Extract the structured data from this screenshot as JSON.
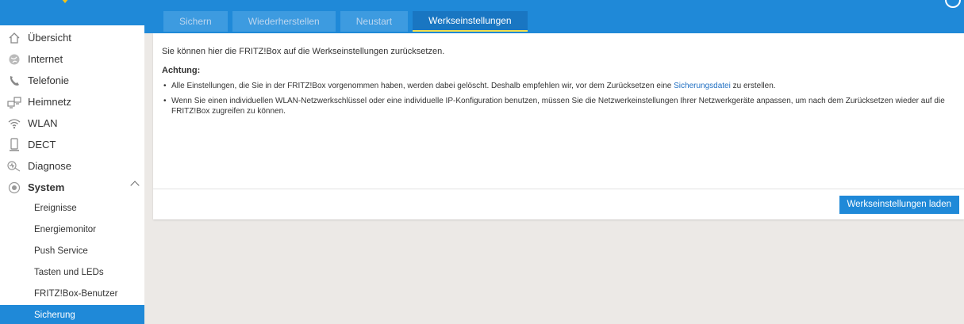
{
  "header": {
    "tabs": [
      {
        "label": "Sichern",
        "active": false
      },
      {
        "label": "Wiederherstellen",
        "active": false
      },
      {
        "label": "Neustart",
        "active": false
      },
      {
        "label": "Werkseinstellungen",
        "active": true
      }
    ]
  },
  "sidebar": {
    "items": [
      {
        "label": "Übersicht",
        "icon": "home-icon"
      },
      {
        "label": "Internet",
        "icon": "globe-icon"
      },
      {
        "label": "Telefonie",
        "icon": "phone-icon"
      },
      {
        "label": "Heimnetz",
        "icon": "network-icon"
      },
      {
        "label": "WLAN",
        "icon": "wifi-icon"
      },
      {
        "label": "DECT",
        "icon": "dect-phone-icon"
      },
      {
        "label": "Diagnose",
        "icon": "diagnose-icon"
      },
      {
        "label": "System",
        "icon": "system-icon",
        "expanded": true
      }
    ],
    "sub_items": [
      {
        "label": "Ereignisse",
        "active": false
      },
      {
        "label": "Energiemonitor",
        "active": false
      },
      {
        "label": "Push Service",
        "active": false
      },
      {
        "label": "Tasten und LEDs",
        "active": false
      },
      {
        "label": "FRITZ!Box-Benutzer",
        "active": false
      },
      {
        "label": "Sicherung",
        "active": true
      }
    ]
  },
  "main": {
    "intro": "Sie können hier die FRITZ!Box auf die Werkseinstellungen zurücksetzen.",
    "warning_heading": "Achtung:",
    "bullet1_before": "Alle Einstellungen, die Sie in der FRITZ!Box vorgenommen haben, werden dabei gelöscht. Deshalb empfehlen wir, vor dem Zurücksetzen eine",
    "bullet1_link": "Sicherungsdatei",
    "bullet1_after": "zu erstellen.",
    "bullet2": "Wenn Sie einen individuellen WLAN-Netzwerkschlüssel oder eine individuelle IP-Konfiguration benutzen, müssen Sie die Netzwerkeinstellungen Ihrer Netzwerkgeräte anpassen, um nach dem Zurücksetzen wieder auf die FRITZ!Box zugreifen zu können.",
    "action_button": "Werkseinstellungen laden"
  },
  "colors": {
    "accent": "#1f89d8",
    "active_tab": "#1976c2",
    "tab_underline": "#f3e04f",
    "background": "#ece9e6"
  }
}
